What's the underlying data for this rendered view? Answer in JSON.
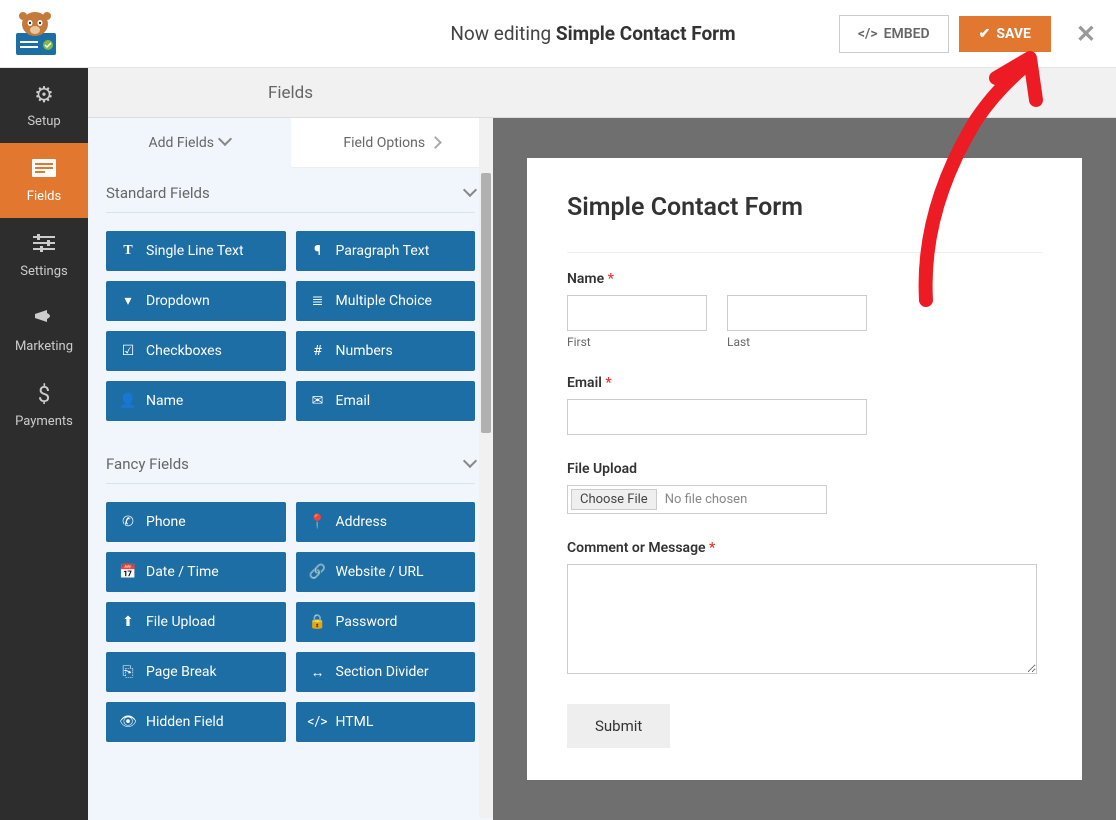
{
  "top": {
    "now_editing": "Now editing",
    "form_name": "Simple Contact Form",
    "embed": "EMBED",
    "save": "SAVE"
  },
  "nav": {
    "setup": "Setup",
    "fields": "Fields",
    "settings": "Settings",
    "marketing": "Marketing",
    "payments": "Payments"
  },
  "header_label": "Fields",
  "tabs": {
    "add_fields": "Add Fields",
    "field_options": "Field Options"
  },
  "sections": {
    "standard": "Standard Fields",
    "fancy": "Fancy Fields"
  },
  "standard_fields": [
    {
      "icon": "text-icon",
      "label": "Single Line Text"
    },
    {
      "icon": "paragraph-icon",
      "label": "Paragraph Text"
    },
    {
      "icon": "dropdown-icon",
      "label": "Dropdown"
    },
    {
      "icon": "multiple-choice-icon",
      "label": "Multiple Choice"
    },
    {
      "icon": "checkboxes-icon",
      "label": "Checkboxes"
    },
    {
      "icon": "numbers-icon",
      "label": "Numbers"
    },
    {
      "icon": "name-icon",
      "label": "Name"
    },
    {
      "icon": "email-icon",
      "label": "Email"
    }
  ],
  "fancy_fields": [
    {
      "icon": "phone-icon",
      "label": "Phone"
    },
    {
      "icon": "address-icon",
      "label": "Address"
    },
    {
      "icon": "date-icon",
      "label": "Date / Time"
    },
    {
      "icon": "url-icon",
      "label": "Website / URL"
    },
    {
      "icon": "upload-icon",
      "label": "File Upload"
    },
    {
      "icon": "password-icon",
      "label": "Password"
    },
    {
      "icon": "pagebreak-icon",
      "label": "Page Break"
    },
    {
      "icon": "section-icon",
      "label": "Section Divider"
    },
    {
      "icon": "hidden-icon",
      "label": "Hidden Field"
    },
    {
      "icon": "html-icon",
      "label": "HTML"
    }
  ],
  "preview": {
    "title": "Simple Contact Form",
    "name_label": "Name",
    "first": "First",
    "last": "Last",
    "email_label": "Email",
    "file_label": "File Upload",
    "choose_file": "Choose File",
    "no_file": "No file chosen",
    "comment_label": "Comment or Message",
    "submit": "Submit"
  }
}
